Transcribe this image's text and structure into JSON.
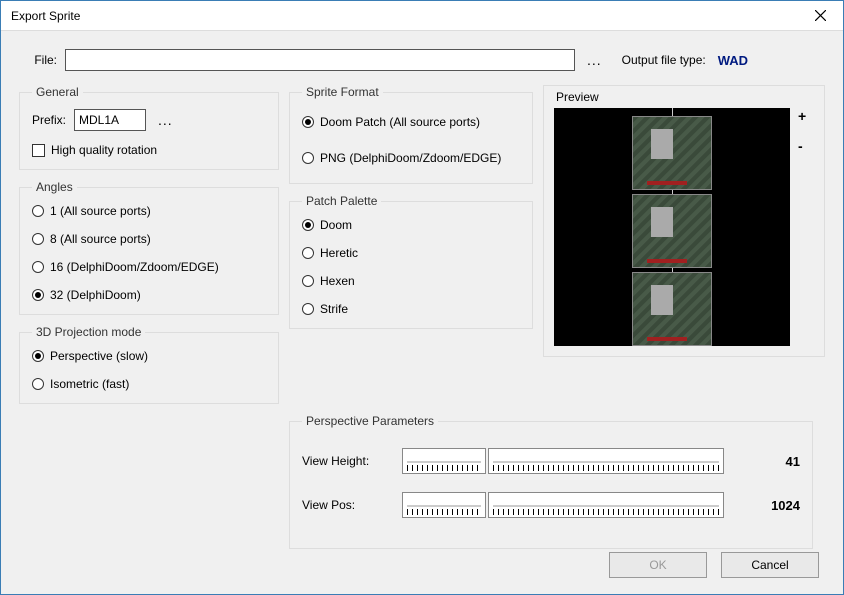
{
  "window": {
    "title": "Export Sprite"
  },
  "file": {
    "label": "File:",
    "value": "",
    "ellipsis": "...",
    "output_label": "Output file type:",
    "output_value": "WAD"
  },
  "general": {
    "legend": "General",
    "prefix_label": "Prefix:",
    "prefix_value": "MDL1A",
    "ellipsis": "...",
    "hq_rotation": "High quality rotation"
  },
  "angles": {
    "legend": "Angles",
    "options": [
      "1 (All source ports)",
      "8 (All source ports)",
      "16 (DelphiDoom/Zdoom/EDGE)",
      "32 (DelphiDoom)"
    ],
    "selected": 3
  },
  "projection": {
    "legend": "3D Projection mode",
    "options": [
      "Perspective (slow)",
      "Isometric (fast)"
    ],
    "selected": 0
  },
  "sprite_format": {
    "legend": "Sprite Format",
    "options": [
      "Doom Patch (All source ports)",
      "PNG (DelphiDoom/Zdoom/EDGE)"
    ],
    "selected": 0
  },
  "palette": {
    "legend": "Patch Palette",
    "options": [
      "Doom",
      "Heretic",
      "Hexen",
      "Strife"
    ],
    "selected": 0
  },
  "preview": {
    "legend": "Preview",
    "zoom_in": "+",
    "zoom_out": "-"
  },
  "perspective": {
    "legend": "Perspective Parameters",
    "view_height_label": "View Height:",
    "view_height_value": "41",
    "view_pos_label": "View Pos:",
    "view_pos_value": "1024"
  },
  "buttons": {
    "ok": "OK",
    "cancel": "Cancel"
  }
}
